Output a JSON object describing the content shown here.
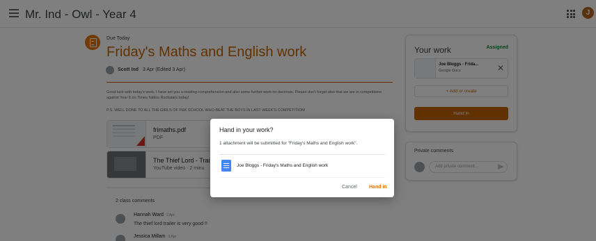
{
  "header": {
    "class_title": "Mr. Ind - Owl - Year 4",
    "avatar_initial": "J"
  },
  "assignment": {
    "due": "Due Today",
    "title": "Friday's Maths and English work",
    "author": "Scott Ind",
    "date": "3 Apr (Edited 3 Apr)",
    "description": "Good luck with today's work. I have set you a reading comprehension and also some further work on decimals. Please don't forget also that we are in competitions against Year 6 on Times Tables Rockstars today!",
    "shoutout": "P.S. WELL DONE TO ALL THE GIRLS OF P&K SCHOOL WHO BEAT THE BOYS IN LAST WEEK'S COMPETITION!",
    "attachments": [
      {
        "title": "frimaths.pdf",
        "subtitle": "PDF"
      },
      {
        "title": "The Thief Lord - Trail",
        "subtitle": "YouTube video · 2 minu"
      }
    ]
  },
  "comments": {
    "heading": "2 class comments",
    "items": [
      {
        "name": "Hannah Ward",
        "date": "3 Apr",
        "text": "The thief lord trailer is very good !!"
      },
      {
        "name": "Jessica Millam",
        "date": "3 Apr",
        "text": ""
      }
    ]
  },
  "your_work": {
    "title": "Your work",
    "status": "Assigned",
    "attachment_name": "Joe Bloggs - Frida...",
    "attachment_type": "Google Docs",
    "add_label": "+ Add or create",
    "hand_in_label": "Hand in",
    "status_color": "#188038",
    "accent_color": "#c26401"
  },
  "private_comments": {
    "title": "Private comments",
    "placeholder": "Add private comment..."
  },
  "dialog": {
    "title": "Hand in your work?",
    "message": "1 attachment will be submitted for \"Friday's Maths and English work\".",
    "doc_name": "Joe Bloggs - Friday's Maths and English work",
    "cancel_label": "Cancel",
    "confirm_label": "Hand in"
  },
  "icons": [
    "menu-icon",
    "apps-grid-icon",
    "assignment-icon",
    "pdf-icon",
    "close-icon",
    "send-icon",
    "google-docs-icon"
  ]
}
